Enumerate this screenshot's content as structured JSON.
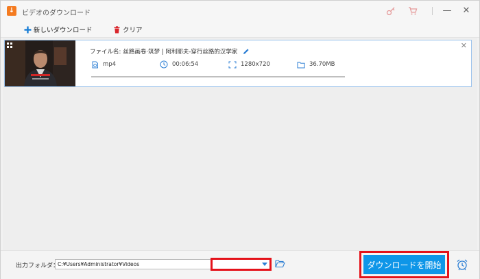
{
  "window": {
    "title": "ビデオのダウンロード",
    "icons": [
      "download-app-icon",
      "key-icon",
      "cart-icon",
      "minimize-icon",
      "close-icon"
    ],
    "minimize_glyph": "—",
    "close_glyph": "✕"
  },
  "toolbar": {
    "new_download_label": "新しいダウンロード",
    "clear_label": "クリア"
  },
  "item": {
    "filename_label": "ファイル名:",
    "filename": "丝路画卷·筑梦 | 阿利耶夫-穿行丝路的汉学家",
    "format": "mp4",
    "duration": "00:06:54",
    "resolution": "1280x720",
    "size": "36.70MB",
    "progress": 0,
    "close_glyph": "✕"
  },
  "bottom": {
    "output_label": "出力フォルダ：",
    "output_path": "C:¥Users¥Administrator¥Videos",
    "start_label": "ダウンロードを開始"
  },
  "colors": {
    "accent": "#0e96e8",
    "highlight": "#e4121a",
    "selection_border": "#9cc3ec"
  }
}
